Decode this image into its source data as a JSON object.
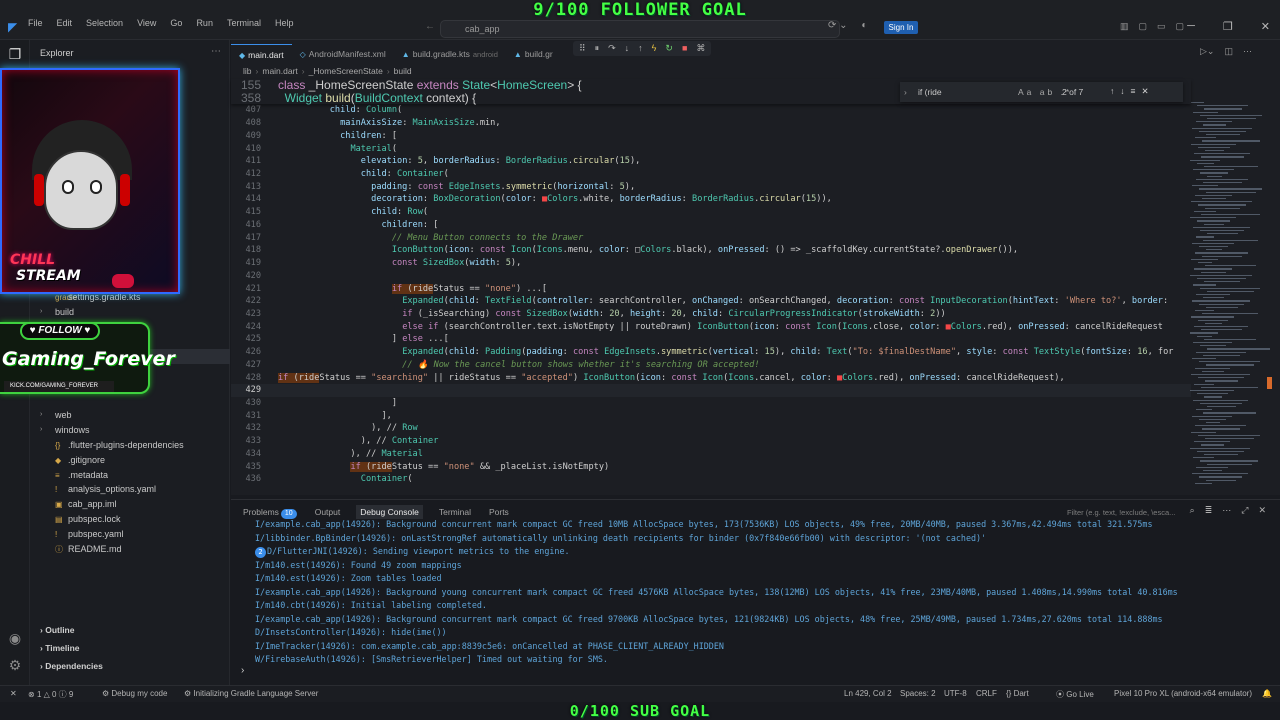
{
  "overlay": {
    "top_goal": "9/100 FOLLOWER GOAL",
    "bottom_goal": "0/100 SUB GOAL",
    "follow": "FOLLOW",
    "stream_chill": "CHILL",
    "stream_word": "STREAM",
    "channel": "Gaming_Forever",
    "channel_url": "KICK.COM/GAMING_FOREVER"
  },
  "menu": [
    "File",
    "Edit",
    "Selection",
    "View",
    "Go",
    "Run",
    "Terminal",
    "Help"
  ],
  "command_center": "cab_app",
  "sign_in": "Sign In",
  "explorer": {
    "title": "Explorer",
    "tree": [
      {
        "label": "settings.gradle.kts",
        "indent": 1,
        "icon": "gradle",
        "chev": ""
      },
      {
        "label": "build",
        "indent": 1,
        "icon": "",
        "chev": "›"
      },
      {
        "label": "",
        "indent": 1,
        "icon": "",
        "chev": ""
      },
      {
        "label": "",
        "indent": 1,
        "icon": "",
        "chev": ""
      },
      {
        "label": "",
        "indent": 1,
        "icon": "",
        "chev": ""
      },
      {
        "label": "",
        "indent": 1,
        "icon": "",
        "chev": ""
      },
      {
        "label": "",
        "indent": 1,
        "icon": "",
        "chev": ""
      },
      {
        "label": "",
        "indent": 1,
        "icon": "",
        "chev": ""
      },
      {
        "label": "web",
        "indent": 1,
        "icon": "",
        "chev": "›"
      },
      {
        "label": "windows",
        "indent": 1,
        "icon": "",
        "chev": "›"
      },
      {
        "label": ".flutter-plugins-dependencies",
        "indent": 1,
        "icon": "{}",
        "chev": ""
      },
      {
        "label": ".gitignore",
        "indent": 1,
        "icon": "◆",
        "chev": ""
      },
      {
        "label": ".metadata",
        "indent": 1,
        "icon": "≡",
        "chev": ""
      },
      {
        "label": "analysis_options.yaml",
        "indent": 1,
        "icon": "!",
        "chev": ""
      },
      {
        "label": "cab_app.iml",
        "indent": 1,
        "icon": "▣",
        "chev": ""
      },
      {
        "label": "pubspec.lock",
        "indent": 1,
        "icon": "▤",
        "chev": ""
      },
      {
        "label": "pubspec.yaml",
        "indent": 1,
        "icon": "!",
        "chev": ""
      },
      {
        "label": "README.md",
        "indent": 1,
        "icon": "ⓘ",
        "chev": ""
      }
    ],
    "sections": [
      "Outline",
      "Timeline",
      "Dependencies"
    ]
  },
  "tabs": [
    {
      "label": "main.dart",
      "suffix": "",
      "active": true
    },
    {
      "label": "AndroidManifest.xml",
      "suffix": "",
      "active": false
    },
    {
      "label": "build.gradle.kts",
      "suffix": "android",
      "active": false
    },
    {
      "label": "build.gr",
      "suffix": "",
      "active": false
    }
  ],
  "breadcrumb": [
    "lib",
    "main.dart",
    "_HomeScreenState",
    "build"
  ],
  "find": {
    "query": "if (ride",
    "count": "2 of 7",
    "opts": "Aa ab .*"
  },
  "sticky_lines": [
    {
      "n": "155",
      "t": "class _HomeScreenState extends State<HomeScreen> {"
    },
    {
      "n": "358",
      "t": "  Widget build(BuildContext context) {"
    }
  ],
  "code": [
    {
      "n": "407",
      "t": "          child: Column("
    },
    {
      "n": "408",
      "t": "            mainAxisSize: MainAxisSize.min,"
    },
    {
      "n": "409",
      "t": "            children: ["
    },
    {
      "n": "410",
      "t": "              Material("
    },
    {
      "n": "411",
      "t": "                elevation: 5, borderRadius: BorderRadius.circular(15),"
    },
    {
      "n": "412",
      "t": "                child: Container("
    },
    {
      "n": "413",
      "t": "                  padding: const EdgeInsets.symmetric(horizontal: 5),"
    },
    {
      "n": "414",
      "t": "                  decoration: BoxDecoration(color: ■Colors.white, borderRadius: BorderRadius.circular(15)),"
    },
    {
      "n": "415",
      "t": "                  child: Row("
    },
    {
      "n": "416",
      "t": "                    children: ["
    },
    {
      "n": "417",
      "t": "                      // Menu Button connects to the Drawer"
    },
    {
      "n": "418",
      "t": "                      IconButton(icon: const Icon(Icons.menu, color: □Colors.black), onPressed: () => _scaffoldKey.currentState?.openDrawer()),"
    },
    {
      "n": "419",
      "t": "                      const SizedBox(width: 5),"
    },
    {
      "n": "420",
      "t": ""
    },
    {
      "n": "421",
      "t": "                      if (rideStatus == \"none\") ...["
    },
    {
      "n": "422",
      "t": "                        Expanded(child: TextField(controller: searchController, onChanged: onSearchChanged, decoration: const InputDecoration(hintText: 'Where to?', border:"
    },
    {
      "n": "423",
      "t": "                        if (_isSearching) const SizedBox(width: 20, height: 20, child: CircularProgressIndicator(strokeWidth: 2))"
    },
    {
      "n": "424",
      "t": "                        else if (searchController.text.isNotEmpty || routeDrawn) IconButton(icon: const Icon(Icons.close, color: ■Colors.red), onPressed: cancelRideRequest"
    },
    {
      "n": "425",
      "t": "                      ] else ...["
    },
    {
      "n": "426",
      "t": "                        Expanded(child: Padding(padding: const EdgeInsets.symmetric(vertical: 15), child: Text(\"To: $finalDestName\", style: const TextStyle(fontSize: 16, for"
    },
    {
      "n": "427",
      "t": "                        // 🔥 Now the cancel button shows whether it's searching OR accepted!"
    },
    {
      "n": "428",
      "t": "if (rideStatus == \"searching\" || rideStatus == \"accepted\") IconButton(icon: const Icon(Icons.cancel, color: ■Colors.red), onPressed: cancelRideRequest),"
    },
    {
      "n": "429",
      "t": ""
    },
    {
      "n": "430",
      "t": "                      ]"
    },
    {
      "n": "431",
      "t": "                    ],"
    },
    {
      "n": "432",
      "t": "                  ), // Row"
    },
    {
      "n": "433",
      "t": "                ), // Container"
    },
    {
      "n": "434",
      "t": "              ), // Material"
    },
    {
      "n": "435",
      "t": "              if (rideStatus == \"none\" && _placeList.isNotEmpty)"
    },
    {
      "n": "436",
      "t": "                Container("
    }
  ],
  "panel": {
    "tabs": [
      {
        "label": "Problems",
        "badge": "10"
      },
      {
        "label": "Output",
        "badge": ""
      },
      {
        "label": "Debug Console",
        "badge": ""
      },
      {
        "label": "Terminal",
        "badge": ""
      },
      {
        "label": "Ports",
        "badge": ""
      }
    ],
    "filter_placeholder": "Filter (e.g. text, !exclude, \\esca...",
    "log": [
      "I/example.cab_app(14926): Background concurrent mark compact GC freed 10MB AllocSpace bytes, 173(7536KB) LOS objects, 49% free, 20MB/40MB, paused 3.367ms,42.494ms total 321.575ms",
      "I/libbinder.BpBinder(14926): onLastStrongRef automatically unlinking death recipients for binder (0x7f840e66fb00) with descriptor: '(not cached)'",
      "D/FlutterJNI(14926): Sending viewport metrics to the engine.",
      "I/m140.est(14926): Found 49 zoom mappings",
      "I/m140.est(14926): Zoom tables loaded",
      "I/example.cab_app(14926): Background young concurrent mark compact GC freed 4576KB AllocSpace bytes, 138(12MB) LOS objects, 41% free, 23MB/40MB, paused 1.408ms,14.990ms total 40.816ms",
      "I/m140.cbt(14926): Initial labeling completed.",
      "I/example.cab_app(14926): Background concurrent mark compact GC freed 9700KB AllocSpace bytes, 121(9824KB) LOS objects, 48% free, 25MB/49MB, paused 1.734ms,27.620ms total 114.888ms",
      "D/InsetsController(14926): hide(ime())",
      "I/ImeTracker(14926): com.example.cab_app:8839c5e6: onCancelled at PHASE_CLIENT_ALREADY_HIDDEN",
      "W/FirebaseAuth(14926): [SmsRetrieverHelper] Timed out waiting for SMS."
    ],
    "log_badge": "2"
  },
  "status": {
    "errors": "1",
    "warnings": "0",
    "info": "9",
    "debug": "Debug my code",
    "task": "Initializing Gradle Language Server",
    "position": "Ln 429, Col 2",
    "spaces": "Spaces: 2",
    "encoding": "UTF-8",
    "eol": "CRLF",
    "lang": "Dart",
    "golive": "Go Live",
    "device": "Pixel 10 Pro XL (android-x64 emulator)"
  }
}
